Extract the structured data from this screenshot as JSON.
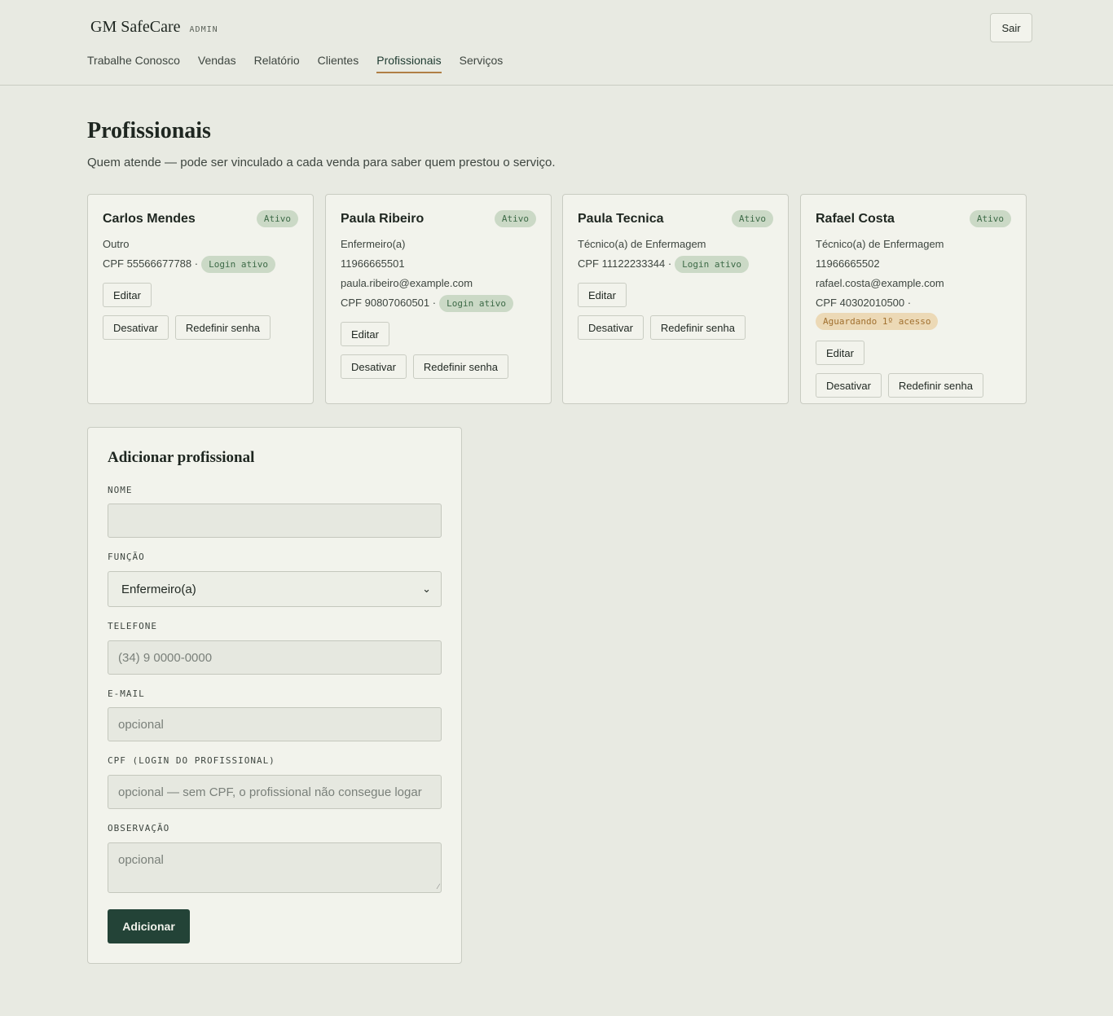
{
  "header": {
    "brand": "GM SafeCare",
    "tag": "ADMIN",
    "logout_label": "Sair",
    "nav": [
      {
        "label": "Trabalhe Conosco"
      },
      {
        "label": "Vendas"
      },
      {
        "label": "Relatório"
      },
      {
        "label": "Clientes"
      },
      {
        "label": "Profissionais",
        "active": true
      },
      {
        "label": "Serviços"
      }
    ]
  },
  "page": {
    "title": "Profissionais",
    "subtitle": "Quem atende — pode ser vinculado a cada venda para saber quem prestou o serviço."
  },
  "professionals": [
    {
      "name": "Carlos Mendes",
      "status": "Ativo",
      "role": "Outro",
      "cpf": "CPF 55566677788 ·",
      "login_badge": "Login ativo",
      "edit_label": "Editar",
      "deactivate_label": "Desativar",
      "reset_label": "Redefinir senha"
    },
    {
      "name": "Paula Ribeiro",
      "status": "Ativo",
      "role": "Enfermeiro(a)",
      "phone": "11966665501",
      "email": "paula.ribeiro@example.com",
      "cpf": "CPF 90807060501 ·",
      "login_badge": "Login ativo",
      "edit_label": "Editar",
      "deactivate_label": "Desativar",
      "reset_label": "Redefinir senha"
    },
    {
      "name": "Paula Tecnica",
      "status": "Ativo",
      "role": "Técnico(a) de Enfermagem",
      "cpf": "CPF 11122233344 ·",
      "login_badge": "Login ativo",
      "edit_label": "Editar",
      "deactivate_label": "Desativar",
      "reset_label": "Redefinir senha"
    },
    {
      "name": "Rafael Costa",
      "status": "Ativo",
      "role": "Técnico(a) de Enfermagem",
      "phone": "11966665502",
      "email": "rafael.costa@example.com",
      "cpf": "CPF 40302010500 ·",
      "login_badge": "Aguardando 1º acesso",
      "edit_label": "Editar",
      "deactivate_label": "Desativar",
      "reset_label": "Redefinir senha"
    }
  ],
  "form": {
    "title": "Adicionar profissional",
    "name_label": "NOME",
    "name_value": "",
    "role_label": "FUNÇÃO",
    "role_value": "Enfermeiro(a)",
    "phone_label": "TELEFONE",
    "phone_placeholder": "(34) 9 0000-0000",
    "email_label": "E-MAIL",
    "email_placeholder": "opcional",
    "cpf_label": "CPF (LOGIN DO PROFISSIONAL)",
    "cpf_placeholder": "opcional — sem CPF, o profissional não consegue logar",
    "note_label": "OBSERVAÇÃO",
    "note_placeholder": "opcional",
    "submit_label": "Adicionar"
  },
  "colors": {
    "background": "#e8eae2",
    "card": "#f2f3ec",
    "accent": "#234337",
    "nav_underline": "#b07f45",
    "badge_ok": "#cbd9c6",
    "badge_pending": "#ecd9b6"
  }
}
